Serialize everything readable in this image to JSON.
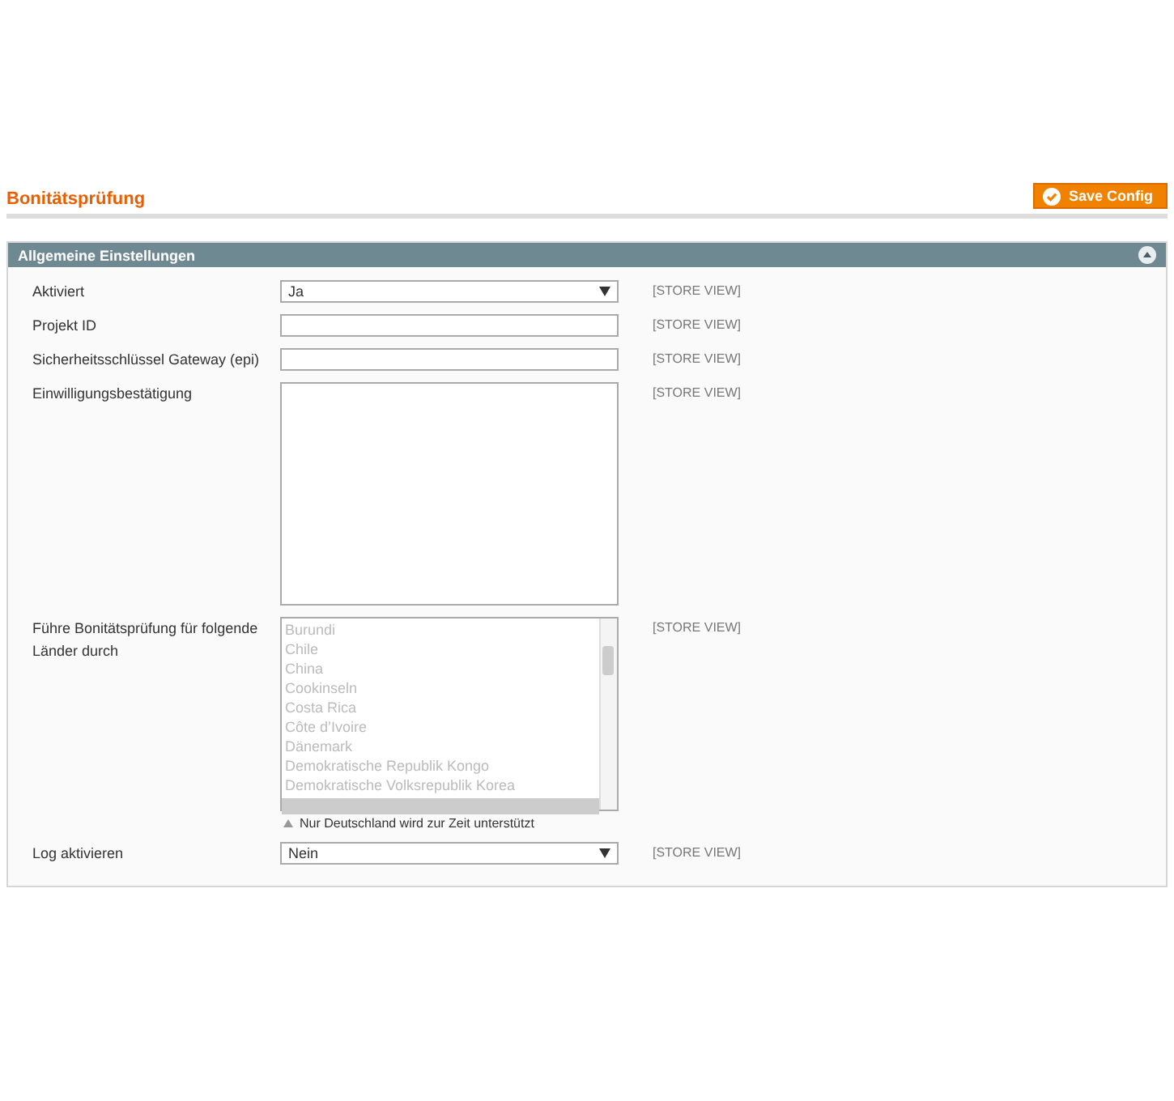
{
  "page": {
    "title": "Bonitätsprüfung",
    "save_button": "Save Config"
  },
  "section": {
    "title": "Allgemeine Einstellungen",
    "expanded": true
  },
  "fields": [
    {
      "kind": "select",
      "label": "Aktiviert",
      "value": "Ja",
      "scope": "[STORE VIEW]"
    },
    {
      "kind": "text",
      "label": "Projekt ID",
      "scope": "[STORE VIEW]"
    },
    {
      "kind": "text",
      "label": "Sicherheitsschlüssel Gateway (epi)",
      "scope": "[STORE VIEW]"
    },
    {
      "kind": "textarea",
      "label": "Einwilligungsbestätigung",
      "scope": "[STORE VIEW]"
    },
    {
      "kind": "multiselect",
      "label": "Führe Bonitätsprüfung für folgende Länder durch",
      "scope": "[STORE VIEW]",
      "note": "Nur Deutschland wird zur Zeit unterstützt",
      "options": [
        {
          "label": "Burundi",
          "disabled": true
        },
        {
          "label": "Chile",
          "disabled": true
        },
        {
          "label": "China",
          "disabled": true
        },
        {
          "label": "Cookinseln",
          "disabled": true
        },
        {
          "label": "Costa Rica",
          "disabled": true
        },
        {
          "label": "Côte d’Ivoire",
          "disabled": true
        },
        {
          "label": "Dänemark",
          "disabled": true
        },
        {
          "label": "Demokratische Republik Kongo",
          "disabled": true
        },
        {
          "label": "Demokratische Volksrepublik Korea",
          "disabled": true
        }
      ]
    },
    {
      "kind": "select",
      "label": "Log aktivieren",
      "value": "Nein",
      "scope": "[STORE VIEW]"
    }
  ]
}
